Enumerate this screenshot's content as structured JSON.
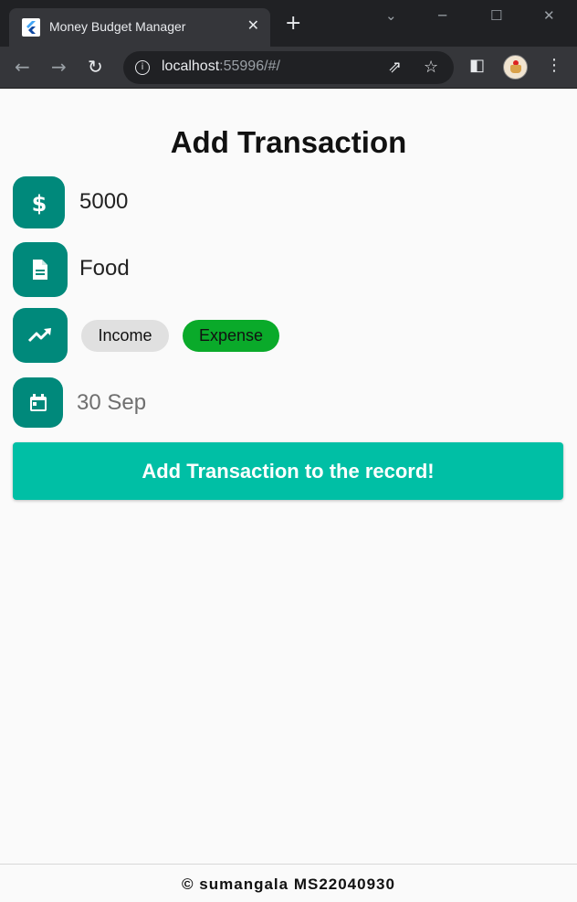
{
  "browser": {
    "tab_title": "Money Budget Manager",
    "url_host": "localhost",
    "url_rest": ":55996/#/"
  },
  "app": {
    "heading": "Add Transaction",
    "amount_value": "5000",
    "note_value": "Food",
    "type_options": [
      "Income",
      "Expense"
    ],
    "selected_type": "Expense",
    "date_value": "30 Sep",
    "submit_label": "Add Transaction to the record!",
    "footer": "© sumangala MS22040930"
  },
  "colors": {
    "icon_bg": "#00897b",
    "submit_bg": "#00bfa5",
    "expense_chip": "#0aaa2a",
    "income_chip": "#e0e0e0"
  }
}
